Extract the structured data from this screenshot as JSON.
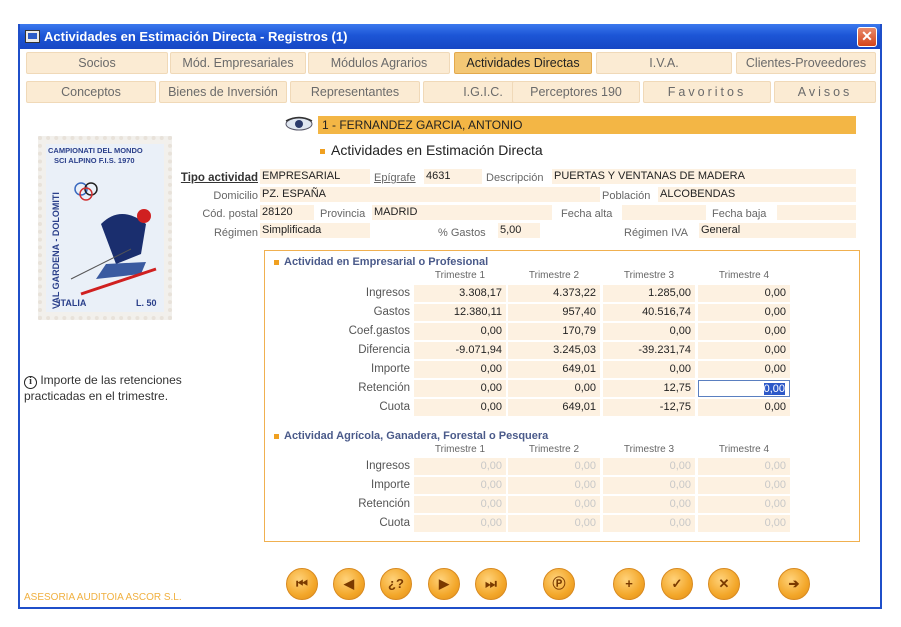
{
  "window": {
    "title": "Actividades en Estimación Directa - Registros (1)",
    "close": "✕"
  },
  "tabs_row1": [
    {
      "label": "Socios"
    },
    {
      "label": "Mód. Empresariales"
    },
    {
      "label": "Módulos Agrarios"
    },
    {
      "label": "Actividades Directas",
      "active": true
    },
    {
      "label": "I.V.A."
    },
    {
      "label": "Clientes-Proveedores"
    }
  ],
  "tabs_row2": [
    {
      "label": "Conceptos"
    },
    {
      "label": "Bienes de Inversión"
    },
    {
      "label": "Representantes"
    },
    {
      "label": "I.G.I.C."
    },
    {
      "label": "Perceptores 190"
    },
    {
      "label": "Favoritos"
    },
    {
      "label": "Avisos"
    }
  ],
  "record": {
    "name": "1 - FERNANDEZ GARCIA, ANTONIO",
    "subtitle": "Actividades en Estimación Directa"
  },
  "stamp": {
    "line1": "CAMPIONATI DEL MONDO",
    "line2": "SCI ALPINO F.I.S. 1970",
    "side": "VAL GARDENA - DOLOMITI",
    "country": "ITALIA",
    "value": "L. 50"
  },
  "form": {
    "tipo_actividad_label": "Tipo actividad",
    "tipo_actividad": "EMPRESARIAL",
    "epigrafe_label": "Epígrafe",
    "epigrafe": "4631",
    "descripcion_label": "Descripción",
    "descripcion": "PUERTAS Y VENTANAS DE MADERA",
    "domicilio_label": "Domicilio",
    "domicilio": "PZ. ESPAÑA",
    "poblacion_label": "Población",
    "poblacion": "ALCOBENDAS",
    "cp_label": "Cód. postal",
    "cp": "28120",
    "provincia_label": "Provincia",
    "provincia": "MADRID",
    "fecha_alta_label": "Fecha alta",
    "fecha_alta": "",
    "fecha_baja_label": "Fecha baja",
    "fecha_baja": "",
    "regimen_label": "Régimen",
    "regimen": "Simplificada",
    "gastos_pct_label": "% Gastos",
    "gastos_pct": "5,00",
    "regimen_iva_label": "Régimen IVA",
    "regimen_iva": "General"
  },
  "info": {
    "icon": "info-icon",
    "text_line1": "Importe de las retenciones",
    "text_line2": "practicadas en el trimestre."
  },
  "empresarial": {
    "title": "Actividad en Empresarial o Profesional",
    "quarters": [
      "Trimestre 1",
      "Trimestre 2",
      "Trimestre 3",
      "Trimestre 4"
    ],
    "rows": [
      {
        "label": "Ingresos",
        "values": [
          "3.308,17",
          "4.373,22",
          "1.285,00",
          "0,00"
        ]
      },
      {
        "label": "Gastos",
        "values": [
          "12.380,11",
          "957,40",
          "40.516,74",
          "0,00"
        ]
      },
      {
        "label": "Coef.gastos",
        "values": [
          "0,00",
          "170,79",
          "0,00",
          "0,00"
        ]
      },
      {
        "label": "Diferencia",
        "values": [
          "-9.071,94",
          "3.245,03",
          "-39.231,74",
          "0,00"
        ]
      },
      {
        "label": "Importe",
        "values": [
          "0,00",
          "649,01",
          "0,00",
          "0,00"
        ]
      },
      {
        "label": "Retención",
        "values": [
          "0,00",
          "0,00",
          "12,75",
          "0,00"
        ]
      },
      {
        "label": "Cuota",
        "values": [
          "0,00",
          "649,01",
          "-12,75",
          "0,00"
        ]
      }
    ]
  },
  "agricola": {
    "title": "Actividad Agrícola, Ganadera, Forestal o Pesquera",
    "quarters": [
      "Trimestre 1",
      "Trimestre 2",
      "Trimestre 3",
      "Trimestre 4"
    ],
    "rows": [
      {
        "label": "Ingresos",
        "values": [
          "0,00",
          "0,00",
          "0,00",
          "0,00"
        ]
      },
      {
        "label": "Importe",
        "values": [
          "0,00",
          "0,00",
          "0,00",
          "0,00"
        ]
      },
      {
        "label": "Retención",
        "values": [
          "0,00",
          "0,00",
          "0,00",
          "0,00"
        ]
      },
      {
        "label": "Cuota",
        "values": [
          "0,00",
          "0,00",
          "0,00",
          "0,00"
        ]
      }
    ]
  },
  "nav_buttons": [
    {
      "name": "first-record-button",
      "glyph": "⏮"
    },
    {
      "name": "previous-record-button",
      "glyph": "◀"
    },
    {
      "name": "search-button",
      "glyph": "¿?"
    },
    {
      "name": "next-record-button",
      "glyph": "▶"
    },
    {
      "name": "last-record-button",
      "glyph": "⏭"
    },
    {
      "name": "print-button",
      "glyph": "Ⓟ"
    },
    {
      "name": "add-button",
      "glyph": "+"
    },
    {
      "name": "accept-button",
      "glyph": "✓"
    },
    {
      "name": "cancel-button",
      "glyph": "✕"
    },
    {
      "name": "exit-button",
      "glyph": "➔"
    }
  ],
  "footer": {
    "company": "ASESORIA AUDITOIA ASCOR S.L."
  },
  "colors": {
    "titlebar": "#1c55d6",
    "tab": "#fbebd3",
    "tab_active": "#f3c775",
    "field": "#fdf1e1",
    "accent": "#f0a020"
  }
}
